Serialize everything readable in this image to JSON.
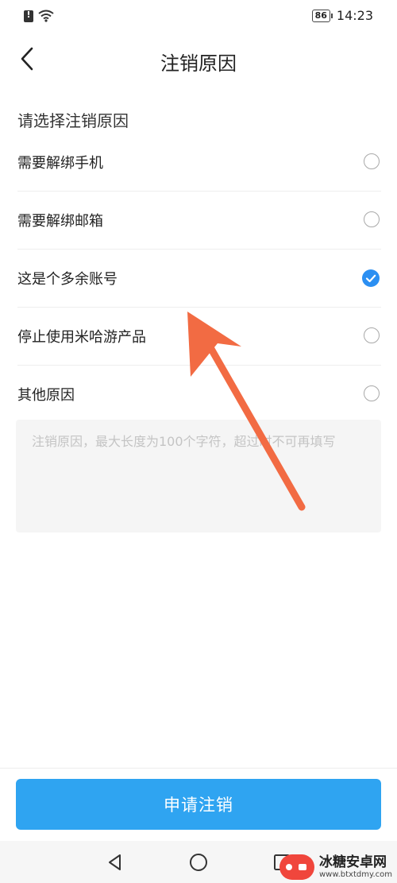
{
  "status_bar": {
    "battery": "86",
    "time": "14:23"
  },
  "header": {
    "title": "注销原因"
  },
  "section": {
    "label": "请选择注销原因"
  },
  "reasons": [
    {
      "label": "需要解绑手机",
      "checked": false
    },
    {
      "label": "需要解绑邮箱",
      "checked": false
    },
    {
      "label": "这是个多余账号",
      "checked": true
    },
    {
      "label": "停止使用米哈游产品",
      "checked": false
    },
    {
      "label": "其他原因",
      "checked": false
    }
  ],
  "reason_input": {
    "placeholder": "注销原因，最大长度为100个字符，超过时不可再填写",
    "value": ""
  },
  "submit_button": {
    "label": "申请注销"
  },
  "watermark": {
    "name": "冰糖安卓网",
    "url": "www.btxtdmy.com"
  },
  "colors": {
    "accent": "#2fa4f1",
    "check": "#2b8ff2",
    "annotation_arrow": "#f26b43",
    "watermark_badge": "#f0463c"
  },
  "icons": {
    "back": "chevron-left-icon",
    "check": "check-icon",
    "nav_back": "triangle-back-icon",
    "nav_home": "circle-home-icon",
    "nav_recent": "square-recent-icon"
  }
}
